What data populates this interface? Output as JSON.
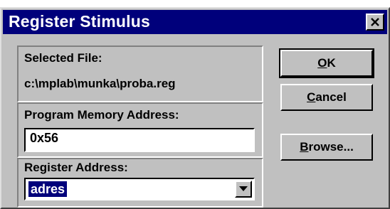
{
  "window": {
    "title": "Register Stimulus",
    "close_icon": "close-icon"
  },
  "file_panel": {
    "selected_file_label": "Selected File:",
    "selected_file_path": "c:\\mplab\\munka\\proba.reg"
  },
  "program_memory": {
    "label": "Program Memory Address:",
    "value": "0x56"
  },
  "register_address": {
    "label": "Register Address:",
    "selected_value": "adres",
    "dropdown_icon": "chevron-down-icon"
  },
  "buttons": {
    "ok": {
      "mnemonic": "O",
      "rest": "K"
    },
    "cancel": {
      "mnemonic": "C",
      "rest": "ancel"
    },
    "browse": {
      "mnemonic": "B",
      "rest": "rowse..."
    }
  },
  "colors": {
    "titlebar": "#00007b",
    "face": "#c0c0c0",
    "selection": "#00007b"
  }
}
